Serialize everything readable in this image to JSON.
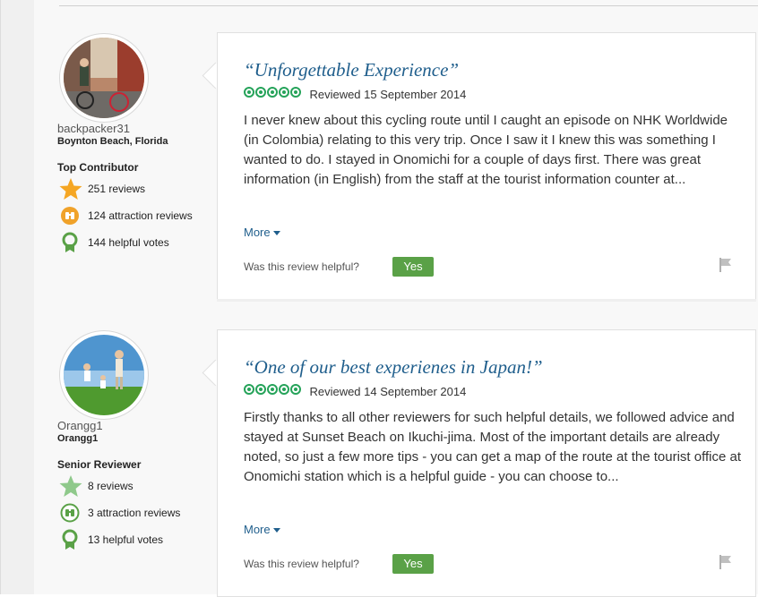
{
  "reviews": [
    {
      "member": {
        "username": "backpacker31",
        "location": "Boynton Beach, Florida",
        "rank": "Top Contributor",
        "badges": {
          "reviews": "251 reviews",
          "attraction_reviews": "124 attraction reviews",
          "helpful_votes": "144 helpful votes"
        },
        "avatar_icon": "cyclist-photo-avatar"
      },
      "title": "“Unforgettable Experience”",
      "rating": 5,
      "reviewed": "Reviewed 15 September 2014",
      "body": "I never knew about this cycling route until I caught an episode on NHK Worldwide (in Colombia) relating to this very trip. Once I saw it I knew this was something I wanted to do. I stayed in Onomichi for a couple of days first. There was great information (in English) from the staff at the tourist information counter at...",
      "more_label": "More",
      "helpful_question": "Was this review helpful?",
      "yes_label": "Yes"
    },
    {
      "member": {
        "username": "Orangg1",
        "location": "Orangg1",
        "rank": "Senior Reviewer",
        "badges": {
          "reviews": "8 reviews",
          "attraction_reviews": "3 attraction reviews",
          "helpful_votes": "13 helpful votes"
        },
        "avatar_icon": "family-photo-avatar"
      },
      "title": "“One of our best experienes in Japan!”",
      "rating": 5,
      "reviewed": "Reviewed 14 September 2014",
      "body": "Firstly thanks to all other reviewers for such helpful details, we followed advice and stayed at Sunset Beach on Ikuchi-jima. Most of the important details are already noted, so just a few more tips - you can get a map of the route at the tourist office at Onomichi station which is a helpful guide - you can choose to...",
      "more_label": "More",
      "helpful_question": "Was this review helpful?",
      "yes_label": "Yes"
    }
  ],
  "colors": {
    "link": "#1f5e8c",
    "bubble": "#26a35a",
    "yes_button": "#5aa147",
    "star_gold": "#f5a623",
    "star_green": "#8fc98b",
    "badge_orange": "#f0a22a",
    "badge_green": "#5aa147"
  }
}
